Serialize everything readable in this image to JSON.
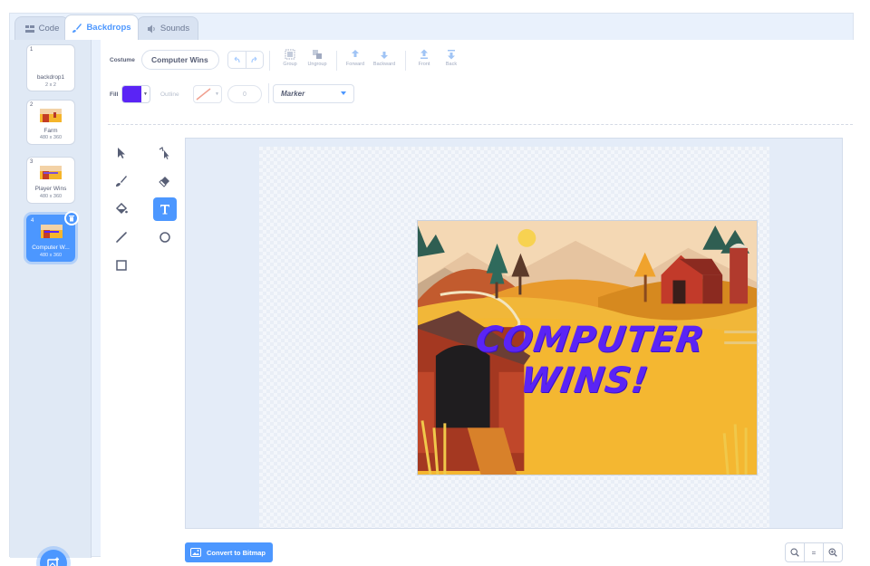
{
  "tabs": [
    {
      "label": "Code",
      "icon": "code-icon"
    },
    {
      "label": "Backdrops",
      "icon": "brush-icon"
    },
    {
      "label": "Sounds",
      "icon": "speaker-icon"
    }
  ],
  "backdrops": [
    {
      "num": "1",
      "name": "backdrop1",
      "size": "2 x 2"
    },
    {
      "num": "2",
      "name": "Farm",
      "size": "480 x 360"
    },
    {
      "num": "3",
      "name": "Player Wins",
      "size": "480 x 360"
    },
    {
      "num": "4",
      "name": "Computer W...",
      "size": "480 x 360"
    }
  ],
  "toolbar": {
    "costume_label": "Costume",
    "costume_name": "Computer Wins",
    "group": "Group",
    "ungroup": "Ungroup",
    "forward": "Forward",
    "backward": "Backward",
    "front": "Front",
    "back": "Back",
    "fill_label": "Fill",
    "outline_label": "Outline",
    "outline_width": "0",
    "font": "Marker"
  },
  "colors": {
    "fill": "#5a24f5",
    "accent": "#4c97ff"
  },
  "canvas": {
    "text": "COMPUTER WINS!"
  },
  "convert_label": "Convert to Bitmap",
  "zoom": {
    "out": "−",
    "reset": "=",
    "in": "+"
  }
}
